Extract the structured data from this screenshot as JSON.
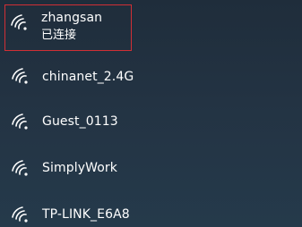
{
  "networks": [
    {
      "ssid": "zhangsan",
      "status": "已连接",
      "icon": "wifi-icon",
      "selected": true
    },
    {
      "ssid": "chinanet_2.4G",
      "icon": "wifi-icon"
    },
    {
      "ssid": "Guest_0113",
      "icon": "wifi-icon"
    },
    {
      "ssid": "SimplyWork",
      "icon": "wifi-icon"
    },
    {
      "ssid": "TP-LINK_E6A8",
      "icon": "wifi-icon"
    }
  ],
  "colors": {
    "selection_border": "#d12f35",
    "text": "#ffffff",
    "background": "#233343"
  }
}
